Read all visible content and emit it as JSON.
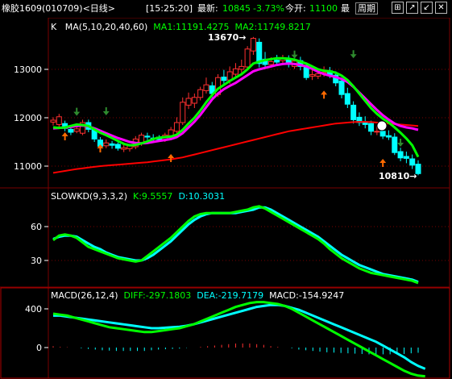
{
  "header": {
    "symbol": "橡胶1609",
    "code": "(010709)",
    "period_tab": "<日线>",
    "time": "[15:25:20]",
    "last_label": "最新:",
    "last_value": "10845",
    "change_pct": "-3.73%",
    "open_label": "今开:",
    "open_value": "11100",
    "more_label": "最",
    "period_button": "周期",
    "window_buttons": [
      "⊞",
      "↗",
      "↙",
      "✕"
    ]
  },
  "kline_panel": {
    "title": "K",
    "ma_params": "MA(5,10,20,40,60)",
    "ma1_label": "MA1:11191.4275",
    "ma2_label": "MA2:11749.8217",
    "high_marker": "13670",
    "low_marker": "10810",
    "y_ticks": [
      "13000",
      "12000",
      "11000"
    ]
  },
  "kd_panel": {
    "title": "SLOWKD(9,3,3,2)",
    "k_label": "K:9.5557",
    "d_label": "D:10.3031",
    "y_ticks": [
      "60",
      "30"
    ]
  },
  "macd_panel": {
    "title": "MACD(26,12,4)",
    "diff_label": "DIFF:-297.1803",
    "dea_label": "DEA:-219.7179",
    "macd_label": "MACD:-154.9247",
    "y_ticks": [
      "400",
      "0"
    ]
  },
  "colors": {
    "up": "#ff3030",
    "down": "#00ffff",
    "ma1": "#00ff00",
    "ma2": "#ff00ff",
    "long_ma": "#ff0000",
    "grid": "#7a0000",
    "axis_text": "#ffffff",
    "label_green": "#00ff00",
    "label_cyan": "#00ffff"
  },
  "chart_data": {
    "type": "line",
    "candles": {
      "o": [
        11910,
        11860,
        11880,
        11760,
        11720,
        11680,
        11900,
        11780,
        11540,
        11420,
        11460,
        11450,
        11350,
        11360,
        11400,
        11470,
        11620,
        11580,
        11600,
        11540,
        11630,
        11720,
        11900,
        12260,
        12300,
        12420,
        12560,
        12660,
        12480,
        12840,
        12780,
        12900,
        13000,
        13050,
        13380,
        13560,
        13210,
        13100,
        13190,
        13180,
        13220,
        13060,
        13180,
        13080,
        12860,
        12860,
        12920,
        12970,
        12880,
        12760,
        12500,
        12260,
        12010,
        11900,
        11880,
        11710,
        11720,
        11630,
        11600,
        11300,
        11200,
        11150,
        11040
      ],
      "c": [
        11950,
        12020,
        11780,
        11700,
        11770,
        11900,
        11760,
        11560,
        11410,
        11480,
        11430,
        11370,
        11380,
        11420,
        11560,
        11640,
        11600,
        11570,
        11550,
        11640,
        11750,
        11900,
        12320,
        12400,
        12420,
        12580,
        12680,
        12500,
        12830,
        12770,
        12950,
        13010,
        13060,
        13420,
        13640,
        13120,
        13100,
        13160,
        13150,
        13240,
        13100,
        13170,
        13060,
        12830,
        12890,
        12910,
        12940,
        12880,
        12720,
        12480,
        12280,
        11960,
        11900,
        11860,
        11720,
        11720,
        11620,
        11600,
        11280,
        11170,
        11160,
        11020,
        10845
      ],
      "h": [
        12010,
        12080,
        11940,
        11820,
        11830,
        11960,
        11960,
        11800,
        11600,
        11550,
        11520,
        11490,
        11460,
        11450,
        11620,
        11690,
        11690,
        11660,
        11640,
        11690,
        11810,
        12010,
        12420,
        12520,
        12500,
        12640,
        12830,
        12740,
        12900,
        12990,
        13060,
        13130,
        13200,
        13480,
        13670,
        13640,
        13360,
        13250,
        13300,
        13300,
        13290,
        13220,
        13260,
        13140,
        12990,
        12990,
        13060,
        13050,
        12960,
        12830,
        12620,
        12340,
        12110,
        12030,
        11940,
        11830,
        11810,
        11740,
        11680,
        11380,
        11300,
        11240,
        11120
      ],
      "l": [
        11840,
        11810,
        11720,
        11640,
        11680,
        11640,
        11700,
        11500,
        11360,
        11370,
        11360,
        11320,
        11290,
        11300,
        11350,
        11420,
        11540,
        11510,
        11520,
        11500,
        11580,
        11660,
        11850,
        12180,
        12200,
        12360,
        12500,
        12420,
        12430,
        12690,
        12700,
        12830,
        12930,
        12980,
        13300,
        13040,
        13030,
        13040,
        13080,
        13120,
        13040,
        13010,
        12980,
        12780,
        12780,
        12800,
        12850,
        12820,
        12650,
        12400,
        12200,
        11880,
        11830,
        11780,
        11640,
        11640,
        11560,
        11540,
        11230,
        11100,
        11060,
        10940,
        10810
      ]
    },
    "ma1": [
      11800,
      11790,
      11800,
      11830,
      11860,
      11850,
      11830,
      11760,
      11690,
      11640,
      11580,
      11520,
      11460,
      11430,
      11440,
      11470,
      11510,
      11560,
      11590,
      11600,
      11610,
      11650,
      11750,
      11880,
      12000,
      12150,
      12320,
      12470,
      12600,
      12680,
      12760,
      12830,
      12900,
      13000,
      13120,
      13160,
      13190,
      13210,
      13230,
      13230,
      13220,
      13200,
      13160,
      13120,
      13060,
      13000,
      12970,
      12960,
      12930,
      12870,
      12780,
      12650,
      12500,
      12350,
      12200,
      12080,
      11980,
      11900,
      11800,
      11690,
      11570,
      11430,
      11190
    ],
    "ma2": [
      11780,
      11790,
      11800,
      11810,
      11830,
      11840,
      11820,
      11780,
      11730,
      11680,
      11630,
      11580,
      11540,
      11500,
      11480,
      11470,
      11480,
      11500,
      11520,
      11540,
      11560,
      11600,
      11680,
      11800,
      11920,
      12060,
      12220,
      12380,
      12500,
      12590,
      12660,
      12720,
      12800,
      12880,
      12960,
      13000,
      13030,
      13060,
      13090,
      13110,
      13120,
      13110,
      13090,
      13060,
      13010,
      12950,
      12900,
      12870,
      12840,
      12800,
      12740,
      12640,
      12520,
      12400,
      12280,
      12160,
      12050,
      11960,
      11880,
      11830,
      11800,
      11780,
      11750
    ],
    "ma_long": [
      10860,
      10880,
      10900,
      10920,
      10940,
      10955,
      10970,
      10985,
      11000,
      11010,
      11020,
      11030,
      11040,
      11050,
      11060,
      11070,
      11080,
      11095,
      11110,
      11125,
      11140,
      11160,
      11180,
      11210,
      11240,
      11270,
      11300,
      11330,
      11360,
      11390,
      11420,
      11450,
      11480,
      11510,
      11540,
      11570,
      11600,
      11630,
      11660,
      11690,
      11720,
      11740,
      11760,
      11780,
      11800,
      11820,
      11840,
      11860,
      11880,
      11890,
      11900,
      11910,
      11915,
      11915,
      11910,
      11900,
      11890,
      11880,
      11870,
      11860,
      11850,
      11840,
      11830
    ],
    "slowkd_k": [
      48,
      52,
      53,
      52,
      50,
      46,
      42,
      40,
      38,
      36,
      34,
      32,
      31,
      30,
      29,
      30,
      34,
      38,
      42,
      46,
      50,
      55,
      60,
      65,
      69,
      71,
      72,
      72,
      72,
      72,
      72,
      73,
      74,
      75,
      77,
      78,
      76,
      73,
      70,
      67,
      64,
      61,
      58,
      55,
      52,
      49,
      45,
      40,
      36,
      32,
      29,
      26,
      23,
      21,
      19,
      18,
      17,
      16,
      15,
      14,
      13,
      12,
      10
    ],
    "slowkd_d": [
      49,
      51,
      52,
      52,
      51,
      48,
      45,
      42,
      40,
      37,
      35,
      33,
      32,
      31,
      30,
      30,
      32,
      35,
      39,
      43,
      47,
      52,
      57,
      62,
      66,
      69,
      71,
      72,
      72,
      72,
      72,
      72,
      73,
      74,
      75,
      77,
      77,
      75,
      72,
      69,
      66,
      63,
      60,
      57,
      54,
      51,
      47,
      43,
      39,
      35,
      32,
      29,
      26,
      24,
      22,
      20,
      18,
      17,
      16,
      15,
      14,
      13,
      11
    ],
    "macd_diff": [
      350,
      340,
      330,
      310,
      290,
      270,
      250,
      230,
      210,
      200,
      190,
      180,
      170,
      160,
      160,
      170,
      180,
      190,
      200,
      220,
      240,
      270,
      300,
      330,
      360,
      390,
      420,
      440,
      460,
      470,
      470,
      460,
      450,
      430,
      400,
      360,
      320,
      280,
      240,
      200,
      160,
      120,
      80,
      40,
      0,
      -40,
      -80,
      -120,
      -160,
      -200,
      -240,
      -270,
      -290,
      -297
    ],
    "macd_dea": [
      330,
      330,
      320,
      310,
      300,
      290,
      280,
      270,
      260,
      250,
      240,
      230,
      220,
      210,
      200,
      200,
      205,
      210,
      215,
      225,
      240,
      260,
      280,
      300,
      320,
      340,
      360,
      380,
      400,
      420,
      430,
      440,
      440,
      430,
      410,
      390,
      360,
      330,
      300,
      270,
      240,
      210,
      180,
      150,
      120,
      90,
      60,
      20,
      -20,
      -60,
      -100,
      -150,
      -190,
      -220
    ],
    "macd_hist": [
      40,
      20,
      10,
      0,
      -20,
      -40,
      -60,
      -80,
      -90,
      -100,
      -100,
      -100,
      -100,
      -100,
      -80,
      -60,
      -50,
      -40,
      -30,
      -10,
      0,
      20,
      40,
      60,
      80,
      100,
      120,
      120,
      120,
      100,
      80,
      40,
      20,
      0,
      -20,
      -60,
      -80,
      -100,
      -120,
      -140,
      -150,
      -160,
      -170,
      -180,
      -190,
      -200,
      -200,
      -200,
      -200,
      -200,
      -190,
      -170,
      -155
    ]
  }
}
